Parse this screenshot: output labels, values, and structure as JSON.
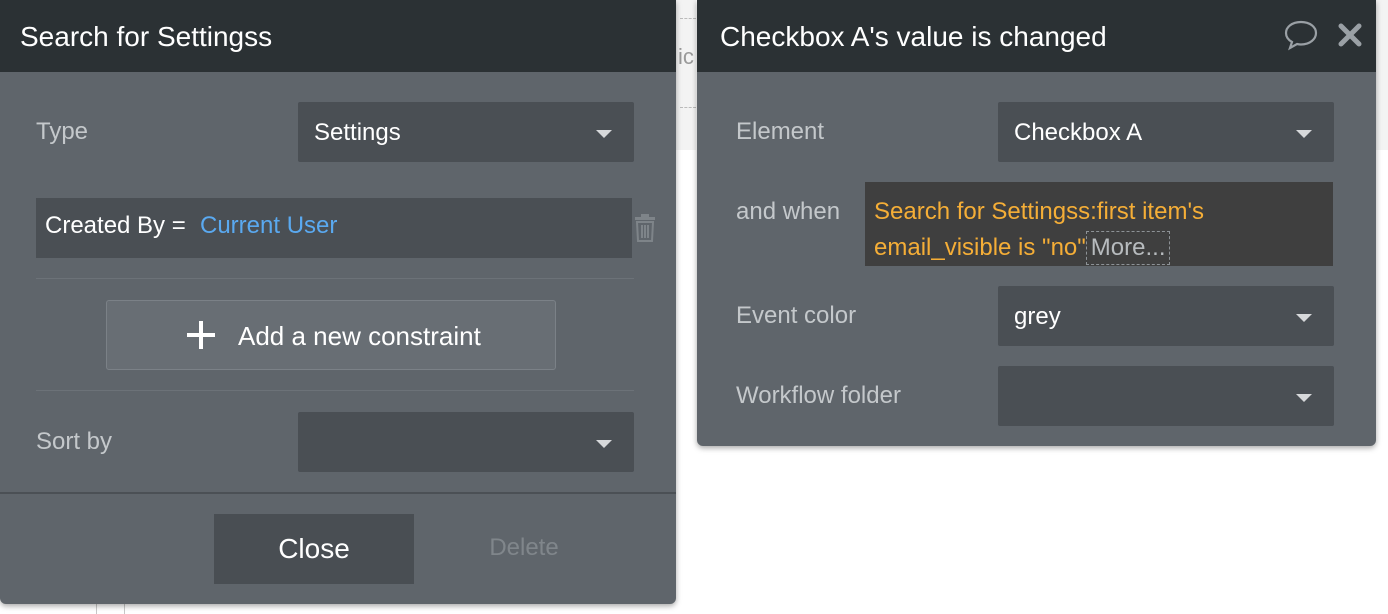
{
  "background": {
    "partial_text": "ic"
  },
  "search_panel": {
    "title": "Search for Settingss",
    "type_label": "Type",
    "type_value": "Settings",
    "constraint": {
      "field": "Created By =",
      "value": "Current User"
    },
    "add_constraint_label": "Add a new constraint",
    "sort_by_label": "Sort by",
    "sort_by_value": "",
    "close_label": "Close",
    "delete_label": "Delete"
  },
  "event_panel": {
    "title": "Checkbox A's value is changed",
    "element_label": "Element",
    "element_value": "Checkbox A",
    "and_when_label": "and when",
    "condition_text": "Search for Settingss:first item's email_visible is \"no\"",
    "more_label": "More...",
    "event_color_label": "Event color",
    "event_color_value": "grey",
    "workflow_folder_label": "Workflow folder",
    "workflow_folder_value": ""
  },
  "icons": {
    "comment": "comment-icon",
    "close": "close-icon",
    "trash": "trash-icon",
    "plus": "plus-icon",
    "dropdown": "chevron-down-icon"
  },
  "colors": {
    "panel_bg": "#5f656b",
    "header_bg": "#2b3134",
    "field_bg": "#4a4f54",
    "dynamic_value": "#5aa9f0",
    "condition_text": "#f5ae37",
    "muted_text": "#c4c8cb"
  }
}
